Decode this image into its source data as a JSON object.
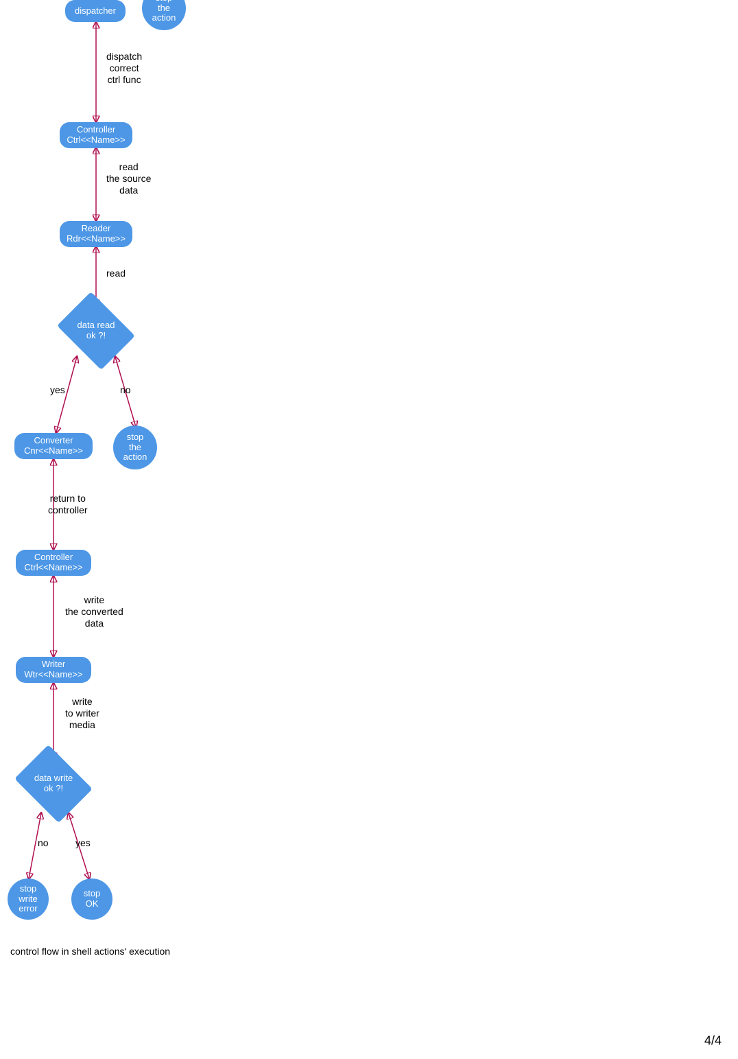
{
  "colors": {
    "node_fill": "#4d97e6",
    "node_text": "#ffffff",
    "edge_stroke": "#b01050",
    "label_text": "#000000"
  },
  "nodes": {
    "dispatcher": {
      "label": "dispatcher",
      "shape": "process"
    },
    "stop_action_top": {
      "label": "stop\nthe\naction",
      "shape": "terminator"
    },
    "controller1": {
      "label": "Controller\nCtrl<<Name>>",
      "shape": "process"
    },
    "reader": {
      "label": "Reader\nRdr<<Name>>",
      "shape": "process"
    },
    "decision_read": {
      "label": "data read\nok ?!",
      "shape": "decision"
    },
    "converter": {
      "label": "Converter\nCnr<<Name>>",
      "shape": "process"
    },
    "stop_action_mid": {
      "label": "stop\nthe\naction",
      "shape": "terminator"
    },
    "controller2": {
      "label": "Controller\nCtrl<<Name>>",
      "shape": "process"
    },
    "writer": {
      "label": "Writer\nWtr<<Name>>",
      "shape": "process"
    },
    "decision_write": {
      "label": "data write\nok ?!",
      "shape": "decision"
    },
    "stop_write_err": {
      "label": "stop\nwrite\nerror",
      "shape": "terminator"
    },
    "stop_ok": {
      "label": "stop\nOK",
      "shape": "terminator"
    }
  },
  "edge_labels": {
    "dispatch": "dispatch\ncorrect\nctrl func",
    "read_source": "read\nthe source\ndata",
    "read": "read",
    "read_yes": "yes",
    "read_no": "no",
    "return_ctrl": "return to\ncontroller",
    "write_conv": "write\nthe converted\ndata",
    "write_media": "write\nto writer\nmedia",
    "write_no": "no",
    "write_yes": "yes"
  },
  "caption": "control flow in shell actions' execution",
  "page_number": "4/4"
}
